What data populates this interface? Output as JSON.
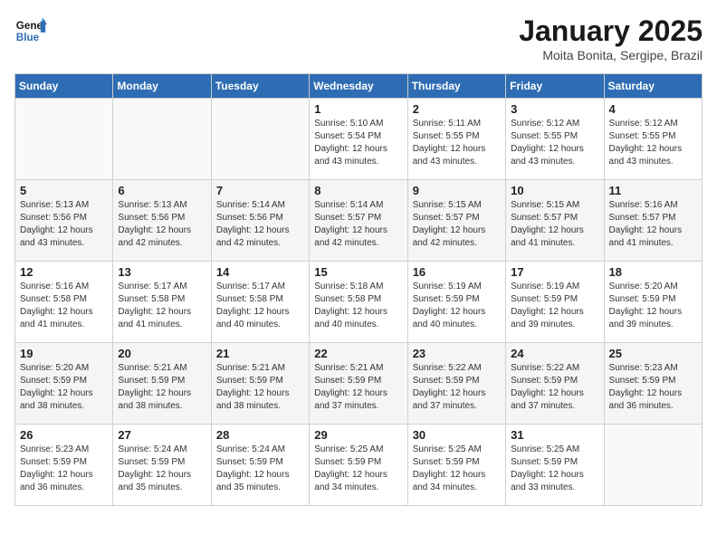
{
  "logo": {
    "line1": "General",
    "line2": "Blue"
  },
  "calendar": {
    "title": "January 2025",
    "subtitle": "Moita Bonita, Sergipe, Brazil"
  },
  "weekdays": [
    "Sunday",
    "Monday",
    "Tuesday",
    "Wednesday",
    "Thursday",
    "Friday",
    "Saturday"
  ],
  "weeks": [
    [
      {
        "day": null,
        "info": ""
      },
      {
        "day": null,
        "info": ""
      },
      {
        "day": null,
        "info": ""
      },
      {
        "day": "1",
        "info": "Sunrise: 5:10 AM\nSunset: 5:54 PM\nDaylight: 12 hours and 43 minutes."
      },
      {
        "day": "2",
        "info": "Sunrise: 5:11 AM\nSunset: 5:55 PM\nDaylight: 12 hours and 43 minutes."
      },
      {
        "day": "3",
        "info": "Sunrise: 5:12 AM\nSunset: 5:55 PM\nDaylight: 12 hours and 43 minutes."
      },
      {
        "day": "4",
        "info": "Sunrise: 5:12 AM\nSunset: 5:55 PM\nDaylight: 12 hours and 43 minutes."
      }
    ],
    [
      {
        "day": "5",
        "info": "Sunrise: 5:13 AM\nSunset: 5:56 PM\nDaylight: 12 hours and 43 minutes."
      },
      {
        "day": "6",
        "info": "Sunrise: 5:13 AM\nSunset: 5:56 PM\nDaylight: 12 hours and 42 minutes."
      },
      {
        "day": "7",
        "info": "Sunrise: 5:14 AM\nSunset: 5:56 PM\nDaylight: 12 hours and 42 minutes."
      },
      {
        "day": "8",
        "info": "Sunrise: 5:14 AM\nSunset: 5:57 PM\nDaylight: 12 hours and 42 minutes."
      },
      {
        "day": "9",
        "info": "Sunrise: 5:15 AM\nSunset: 5:57 PM\nDaylight: 12 hours and 42 minutes."
      },
      {
        "day": "10",
        "info": "Sunrise: 5:15 AM\nSunset: 5:57 PM\nDaylight: 12 hours and 41 minutes."
      },
      {
        "day": "11",
        "info": "Sunrise: 5:16 AM\nSunset: 5:57 PM\nDaylight: 12 hours and 41 minutes."
      }
    ],
    [
      {
        "day": "12",
        "info": "Sunrise: 5:16 AM\nSunset: 5:58 PM\nDaylight: 12 hours and 41 minutes."
      },
      {
        "day": "13",
        "info": "Sunrise: 5:17 AM\nSunset: 5:58 PM\nDaylight: 12 hours and 41 minutes."
      },
      {
        "day": "14",
        "info": "Sunrise: 5:17 AM\nSunset: 5:58 PM\nDaylight: 12 hours and 40 minutes."
      },
      {
        "day": "15",
        "info": "Sunrise: 5:18 AM\nSunset: 5:58 PM\nDaylight: 12 hours and 40 minutes."
      },
      {
        "day": "16",
        "info": "Sunrise: 5:19 AM\nSunset: 5:59 PM\nDaylight: 12 hours and 40 minutes."
      },
      {
        "day": "17",
        "info": "Sunrise: 5:19 AM\nSunset: 5:59 PM\nDaylight: 12 hours and 39 minutes."
      },
      {
        "day": "18",
        "info": "Sunrise: 5:20 AM\nSunset: 5:59 PM\nDaylight: 12 hours and 39 minutes."
      }
    ],
    [
      {
        "day": "19",
        "info": "Sunrise: 5:20 AM\nSunset: 5:59 PM\nDaylight: 12 hours and 38 minutes."
      },
      {
        "day": "20",
        "info": "Sunrise: 5:21 AM\nSunset: 5:59 PM\nDaylight: 12 hours and 38 minutes."
      },
      {
        "day": "21",
        "info": "Sunrise: 5:21 AM\nSunset: 5:59 PM\nDaylight: 12 hours and 38 minutes."
      },
      {
        "day": "22",
        "info": "Sunrise: 5:21 AM\nSunset: 5:59 PM\nDaylight: 12 hours and 37 minutes."
      },
      {
        "day": "23",
        "info": "Sunrise: 5:22 AM\nSunset: 5:59 PM\nDaylight: 12 hours and 37 minutes."
      },
      {
        "day": "24",
        "info": "Sunrise: 5:22 AM\nSunset: 5:59 PM\nDaylight: 12 hours and 37 minutes."
      },
      {
        "day": "25",
        "info": "Sunrise: 5:23 AM\nSunset: 5:59 PM\nDaylight: 12 hours and 36 minutes."
      }
    ],
    [
      {
        "day": "26",
        "info": "Sunrise: 5:23 AM\nSunset: 5:59 PM\nDaylight: 12 hours and 36 minutes."
      },
      {
        "day": "27",
        "info": "Sunrise: 5:24 AM\nSunset: 5:59 PM\nDaylight: 12 hours and 35 minutes."
      },
      {
        "day": "28",
        "info": "Sunrise: 5:24 AM\nSunset: 5:59 PM\nDaylight: 12 hours and 35 minutes."
      },
      {
        "day": "29",
        "info": "Sunrise: 5:25 AM\nSunset: 5:59 PM\nDaylight: 12 hours and 34 minutes."
      },
      {
        "day": "30",
        "info": "Sunrise: 5:25 AM\nSunset: 5:59 PM\nDaylight: 12 hours and 34 minutes."
      },
      {
        "day": "31",
        "info": "Sunrise: 5:25 AM\nSunset: 5:59 PM\nDaylight: 12 hours and 33 minutes."
      },
      {
        "day": null,
        "info": ""
      }
    ]
  ]
}
